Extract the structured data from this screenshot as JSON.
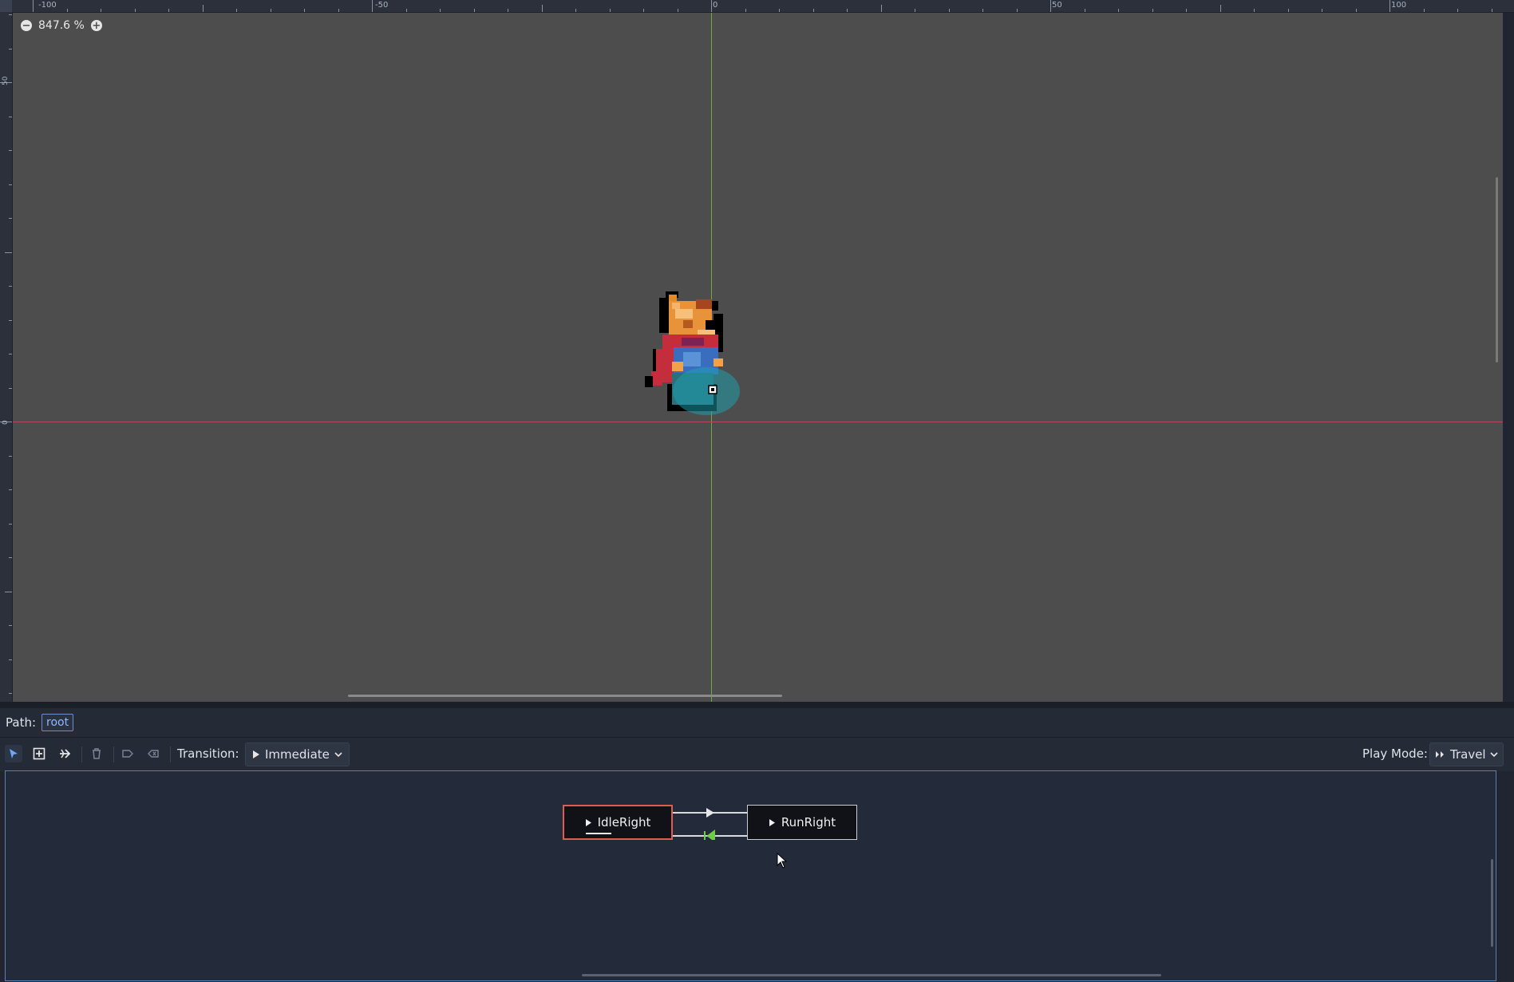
{
  "viewport": {
    "zoom_label": "847.6 %",
    "ruler_top_labels": [
      "-100",
      "-50",
      "0",
      "50",
      "100"
    ],
    "ruler_left_labels": [
      "50",
      "0"
    ]
  },
  "path_bar": {
    "label": "Path:",
    "value": "root"
  },
  "toolbar": {
    "tools": [
      "select-icon",
      "add-node-icon",
      "connect-icon",
      "delete-icon",
      "set-start-icon",
      "set-end-icon"
    ],
    "transition_label": "Transition:",
    "transition_value": "Immediate",
    "play_mode_label": "Play Mode:",
    "play_mode_value": "Travel"
  },
  "state_machine": {
    "nodes": [
      {
        "name": "IdleRight",
        "state": "playing"
      },
      {
        "name": "RunRight",
        "state": "idle"
      }
    ],
    "colors": {
      "active_border": "#e05b52",
      "transition_travel": "#6fca4a",
      "panel_focus_border": "#5d7fb0"
    }
  }
}
